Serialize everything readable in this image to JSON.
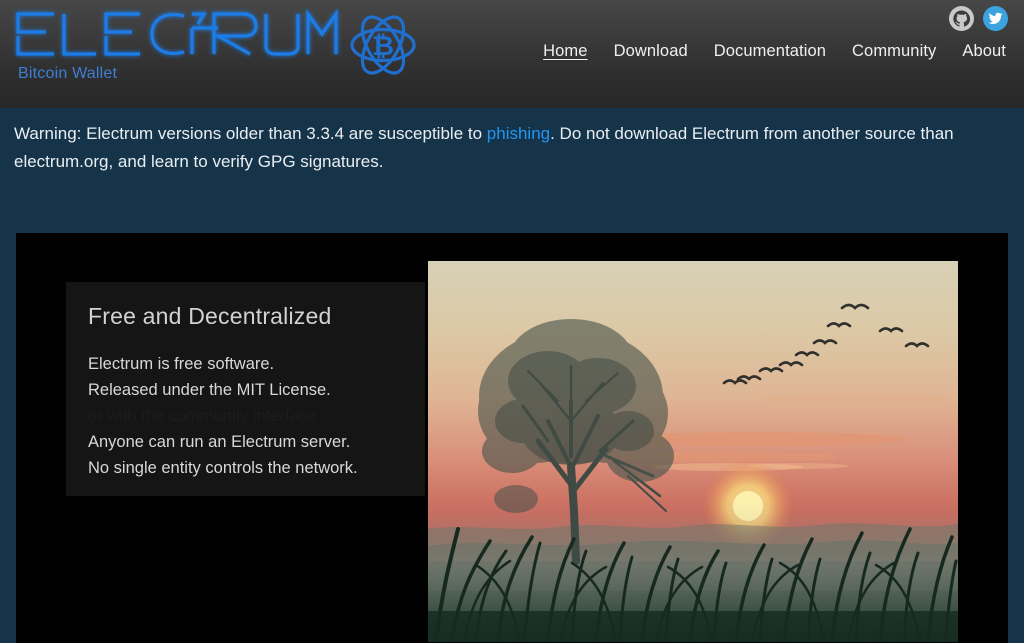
{
  "brand": {
    "wordmark": "ELECTRUM",
    "subtitle": "Bitcoin Wallet",
    "logo_icon": "electrum-atom-bitcoin-icon",
    "accent_color": "#3d7fd6"
  },
  "nav": {
    "items": [
      {
        "label": "Home",
        "active": true
      },
      {
        "label": "Download",
        "active": false
      },
      {
        "label": "Documentation",
        "active": false
      },
      {
        "label": "Community",
        "active": false
      },
      {
        "label": "About",
        "active": false
      }
    ]
  },
  "social": {
    "items": [
      {
        "name": "github-icon",
        "label": "GitHub",
        "color": "#c9c9c9"
      },
      {
        "name": "twitter-icon",
        "label": "Twitter",
        "color": "#3ba3e0"
      }
    ]
  },
  "warning": {
    "prefix": "Warning: Electrum versions older than 3.3.4 are susceptible to ",
    "link_text": "phishing",
    "suffix": ". Do not download Electrum from another source than electrum.org, and learn to verify GPG signatures.",
    "link_color": "#2196f3",
    "background_color": "#163449"
  },
  "hero": {
    "heading": "Free and Decentralized",
    "paragraph_1_line_1": "Electrum is free software.",
    "paragraph_1_line_2": "Released under the MIT License.",
    "ghost_line": "or with the community interface",
    "paragraph_2_line_1": "Anyone can run an Electrum server.",
    "paragraph_2_line_2": "No single entity controls the network.",
    "photo_alt": "Sunset over a misty field with a tree silhouette, flying birds and tall grass"
  }
}
